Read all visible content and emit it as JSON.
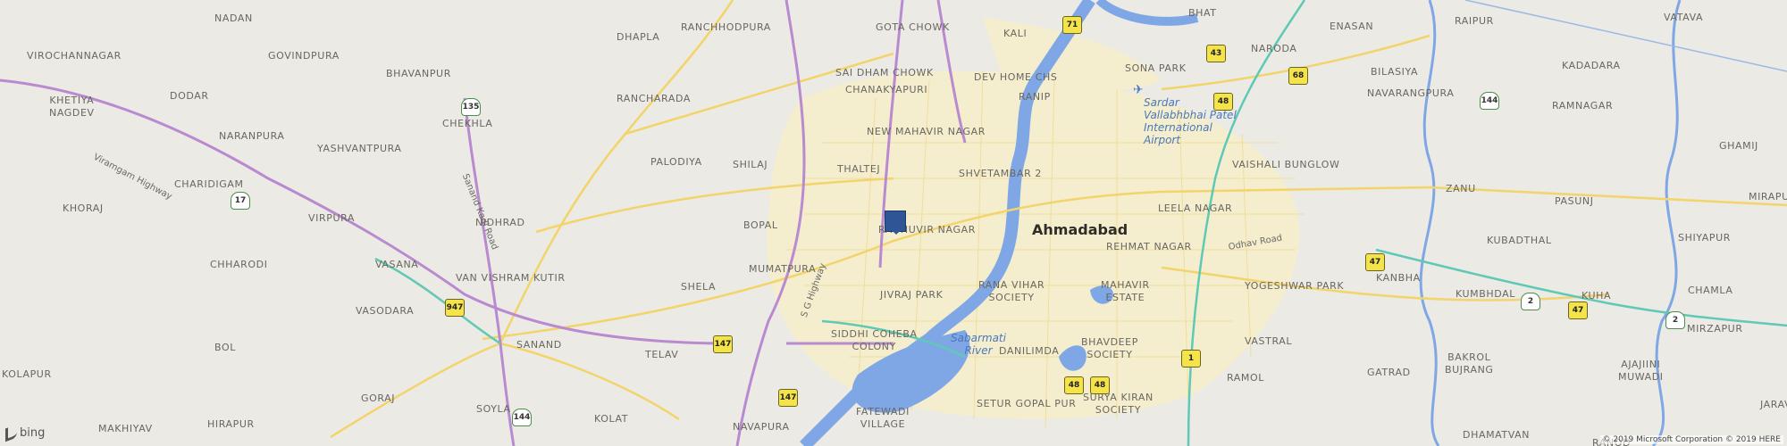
{
  "map": {
    "city": "Ahmadabad",
    "labels": [
      "NADAN",
      "GOVINDPURA",
      "VIROCHANNAGAR",
      "BHAVANPUR",
      "DODAR",
      "KHETIYA NAGDEV",
      "CHEKHLA",
      "NARANPURA",
      "YASHVANTPURA",
      "CHARIDIGAM",
      "KHORAJ",
      "VIRPURA",
      "NIDHRAD",
      "CHHARODI",
      "VASANA",
      "VAN VISHRAM KUTIR",
      "VASODARA",
      "BOL",
      "SANAND",
      "KOLAPUR",
      "GORAJ",
      "MAKHIYAV",
      "HIRAPUR",
      "SOYLA",
      "KOLAT",
      "TELAV",
      "SHELA",
      "MUMATPURA",
      "BOPAL",
      "SIDDHI COHEBA COLONY",
      "FATEWADI VILLAGE",
      "NAVAPURA",
      "DHAPLA",
      "RANCHHODPURA",
      "RANCHARADA",
      "PALODIYA",
      "SHILAJ",
      "THALTEJ",
      "GOTA CHOWK",
      "SAI DHAM CHOWK",
      "CHANAKYAPURI",
      "NEW MAHAVIR NAGAR",
      "DEV HOME CHS",
      "KALI",
      "RANIP",
      "SHVETAMBAR 2",
      "RAGHUVIR NAGAR",
      "JIVRAJ PARK",
      "RANA VIHAR SOCIETY",
      "DANILIMDA",
      "SETUR GOPAL PUR",
      "SURYA KIRAN SOCIETY",
      "BHAVDEEP SOCIETY",
      "MAHAVIR ESTATE",
      "RAMOL",
      "VASTRAL",
      "YOGESHWAR PARK",
      "REHMAT NAGAR",
      "LEELA NAGAR",
      "VAISHALI BUNGLOW",
      "SONA PARK",
      "BHAT",
      "NARODA",
      "ENASAN",
      "RAIPUR",
      "BILASIYA",
      "NAVARANGPURA",
      "RAMNAGAR",
      "KADADARA",
      "VATAVA",
      "GHAMIJ",
      "ZANU",
      "PASUNJ",
      "KUBADTHAL",
      "KUMBHDAL",
      "KANBHA",
      "SHIYAPUR",
      "MIRAPUR",
      "CHAMLA",
      "KUHA",
      "MIRZAPUR",
      "BAKROL BUJRANG",
      "GATRAD",
      "AJAJIINI MUWADI",
      "JARAV",
      "DHAMATVAN",
      "RANOD"
    ],
    "water_labels": [
      "Sabarmati River"
    ],
    "airport_label": "Sardar Vallabhbhai Patel International Airport",
    "road_labels": [
      "Viramgam Highway",
      "Sanand Kadi Road",
      "S G Highway",
      "Odhav Road"
    ],
    "shields": {
      "nh": [
        "71",
        "43",
        "68",
        "48",
        "47",
        "48",
        "1",
        "147",
        "147",
        "947",
        "47",
        "48"
      ],
      "sh": [
        "135",
        "17",
        "144",
        "2",
        "2",
        "144"
      ]
    },
    "marker_icon": "map-pin-square",
    "attribution": {
      "logo": "bing",
      "copyright": "© 2019 Microsoft Corporation © 2019 HERE"
    },
    "colors": {
      "land": "#eceae4",
      "urban": "#f3edcc",
      "water": "#7fa7e6",
      "highway": "#b98ad0",
      "arterial": "#f2d46b",
      "teal_road": "#5fc9b5",
      "marker": "#2f5597"
    }
  }
}
